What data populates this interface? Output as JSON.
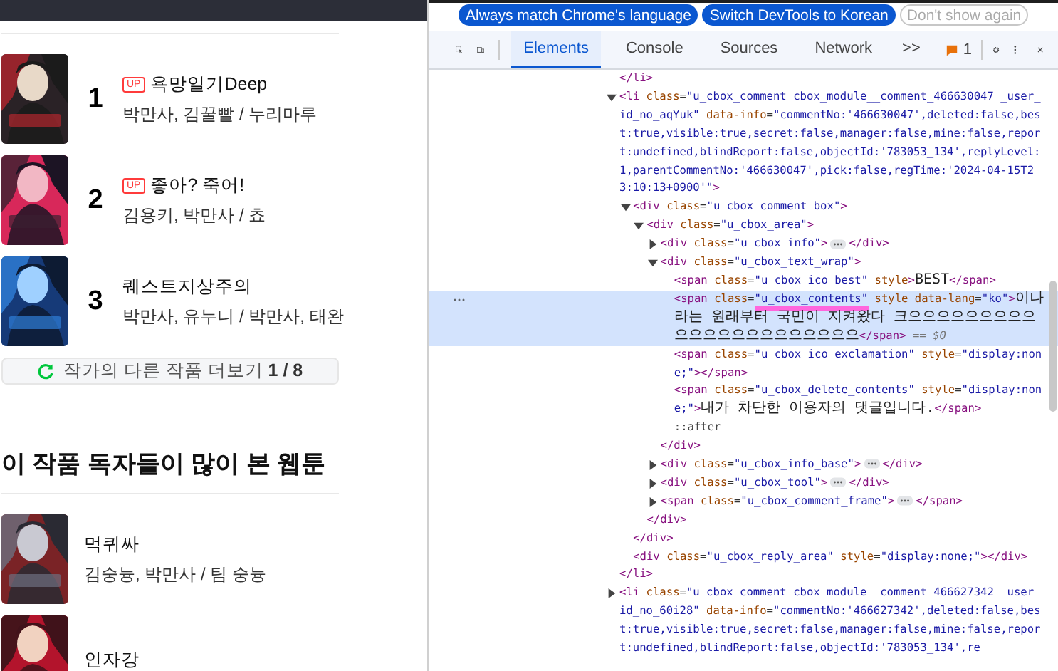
{
  "page": {
    "rankings": [
      {
        "rank": "1",
        "badge": "UP",
        "title": "욕망일기Deep",
        "authors": "박만사, 김꿀빨 / 누리마루"
      },
      {
        "rank": "2",
        "badge": "UP",
        "title": "좋아? 죽어!",
        "authors": "김용키, 박만사 / 쵸"
      },
      {
        "rank": "3",
        "title": "퀘스트지상주의",
        "authors": "박만사, 유누니 / 박만사, 태완"
      }
    ],
    "more_button": "작가의 다른 작품 더보기 **1 / 8**",
    "section_title": "이 작품 독자들이 많이 본 웹툰",
    "recommendations": [
      {
        "title": "먹퀴싸",
        "authors": "김숭늉, 박만사 / 팀 숭늉"
      },
      {
        "title": "인자강"
      }
    ]
  },
  "devtools": {
    "infobar": [
      {
        "label": "Always match Chrome's language",
        "kind": "primary"
      },
      {
        "label": "Switch DevTools to Korean",
        "kind": "primary"
      },
      {
        "label": "Don't show again",
        "kind": "outline"
      }
    ],
    "tabs": [
      {
        "label": "Elements",
        "selected": true
      },
      {
        "label": "Console",
        "selected": false
      },
      {
        "label": "Sources",
        "selected": false
      },
      {
        "label": "Network",
        "selected": false
      }
    ],
    "overflow": ">>",
    "issues": "1",
    "dom": [
      {
        "line": [
          {
            "kind": "tag",
            "text": "</li>"
          }
        ]
      },
      {
        "expanded": true,
        "line": [
          {
            "kind": "tag",
            "text": "<li"
          },
          {
            "kind": "attr",
            "text": " class"
          },
          {
            "kind": "punct",
            "text": "="
          },
          {
            "kind": "value",
            "text": "\"u_cbox_comment cbox_module__comment_466630047 _user_id_no_aqYuk\""
          },
          {
            "kind": "attr",
            "text": " data-info"
          },
          {
            "kind": "punct",
            "text": "="
          },
          {
            "kind": "value",
            "text": "\"commentNo:'466630047',deleted:false,best:true,visible:true,secret:false,manager:false,mine:false,report:undefined,blindReport:false,objectId:'783053_134',replyLevel:1,parentCommentNo:'466630047',pick:false,regTime:'2024-04-15T23:10:13+0900'\""
          },
          {
            "kind": "tag",
            "text": ">"
          }
        ],
        "children": [
          {
            "expanded": true,
            "line": [
              {
                "kind": "tag",
                "text": "<div"
              },
              {
                "kind": "attr",
                "text": " class"
              },
              {
                "kind": "punct",
                "text": "="
              },
              {
                "kind": "value",
                "text": "\"u_cbox_comment_box\""
              },
              {
                "kind": "tag",
                "text": ">"
              }
            ],
            "children": [
              {
                "expanded": true,
                "line": [
                  {
                    "kind": "tag",
                    "text": "<div"
                  },
                  {
                    "kind": "attr",
                    "text": " class"
                  },
                  {
                    "kind": "punct",
                    "text": "="
                  },
                  {
                    "kind": "value",
                    "text": "\"u_cbox_area\""
                  },
                  {
                    "kind": "tag",
                    "text": ">"
                  }
                ],
                "children": [
                  {
                    "expanded": false,
                    "line": [
                      {
                        "kind": "tag",
                        "text": "<div"
                      },
                      {
                        "kind": "attr",
                        "text": " class"
                      },
                      {
                        "kind": "punct",
                        "text": "="
                      },
                      {
                        "kind": "value",
                        "text": "\"u_cbox_info\""
                      },
                      {
                        "kind": "tag",
                        "text": ">"
                      },
                      {
                        "kind": "ellipsis"
                      },
                      {
                        "kind": "tag",
                        "text": "</div>"
                      }
                    ]
                  },
                  {
                    "expanded": true,
                    "line": [
                      {
                        "kind": "tag",
                        "text": "<div"
                      },
                      {
                        "kind": "attr",
                        "text": " class"
                      },
                      {
                        "kind": "punct",
                        "text": "="
                      },
                      {
                        "kind": "value",
                        "text": "\"u_cbox_text_wrap\""
                      },
                      {
                        "kind": "tag",
                        "text": ">"
                      }
                    ],
                    "children": [
                      {
                        "line": [
                          {
                            "kind": "tag",
                            "text": "<span"
                          },
                          {
                            "kind": "attr",
                            "text": " class"
                          },
                          {
                            "kind": "punct",
                            "text": "="
                          },
                          {
                            "kind": "value",
                            "text": "\"u_cbox_ico_best\""
                          },
                          {
                            "kind": "attr",
                            "text": " style"
                          },
                          {
                            "kind": "tag",
                            "text": ">"
                          },
                          {
                            "kind": "text",
                            "text": "BEST"
                          },
                          {
                            "kind": "tag",
                            "text": "</span>"
                          }
                        ]
                      },
                      {
                        "selected": true,
                        "line": [
                          {
                            "kind": "tag",
                            "text": "<span"
                          },
                          {
                            "kind": "attr",
                            "text": " class"
                          },
                          {
                            "kind": "punct",
                            "text": "="
                          },
                          {
                            "kind": "value",
                            "text": "\"u_cbox_contents\"",
                            "marked": true
                          },
                          {
                            "kind": "attr",
                            "text": " style data-lang"
                          },
                          {
                            "kind": "punct",
                            "text": "="
                          },
                          {
                            "kind": "value",
                            "text": "\"ko\""
                          },
                          {
                            "kind": "tag",
                            "text": ">"
                          },
                          {
                            "kind": "text",
                            "text": "이나라는 원래부터 국민이 지켜왔다 크으으으으으으으으으으으으으으으으으으으으으으"
                          },
                          {
                            "kind": "tag",
                            "text": "</span>"
                          },
                          {
                            "kind": "ref",
                            "text": " == $0"
                          }
                        ]
                      },
                      {
                        "line": [
                          {
                            "kind": "tag",
                            "text": "<span"
                          },
                          {
                            "kind": "attr",
                            "text": " class"
                          },
                          {
                            "kind": "punct",
                            "text": "="
                          },
                          {
                            "kind": "value",
                            "text": "\"u_cbox_ico_exclamation\""
                          },
                          {
                            "kind": "attr",
                            "text": " style"
                          },
                          {
                            "kind": "punct",
                            "text": "="
                          },
                          {
                            "kind": "value",
                            "text": "\"display:none;\""
                          },
                          {
                            "kind": "tag",
                            "text": "></span>"
                          }
                        ]
                      },
                      {
                        "line": [
                          {
                            "kind": "tag",
                            "text": "<span"
                          },
                          {
                            "kind": "attr",
                            "text": " class"
                          },
                          {
                            "kind": "punct",
                            "text": "="
                          },
                          {
                            "kind": "value",
                            "text": "\"u_cbox_delete_contents\""
                          },
                          {
                            "kind": "attr",
                            "text": " style"
                          },
                          {
                            "kind": "punct",
                            "text": "="
                          },
                          {
                            "kind": "value",
                            "text": "\"display:none;\""
                          },
                          {
                            "kind": "tag",
                            "text": ">"
                          },
                          {
                            "kind": "text",
                            "text": "내가 차단한 이용자의 댓글입니다."
                          },
                          {
                            "kind": "tag",
                            "text": "</span>"
                          }
                        ]
                      },
                      {
                        "line": [
                          {
                            "kind": "pseudo",
                            "text": "::after"
                          }
                        ]
                      }
                    ],
                    "closing": [
                      {
                        "kind": "tag",
                        "text": "</div>"
                      }
                    ]
                  },
                  {
                    "expanded": false,
                    "line": [
                      {
                        "kind": "tag",
                        "text": "<div"
                      },
                      {
                        "kind": "attr",
                        "text": " class"
                      },
                      {
                        "kind": "punct",
                        "text": "="
                      },
                      {
                        "kind": "value",
                        "text": "\"u_cbox_info_base\""
                      },
                      {
                        "kind": "tag",
                        "text": ">"
                      },
                      {
                        "kind": "ellipsis"
                      },
                      {
                        "kind": "tag",
                        "text": "</div>"
                      }
                    ]
                  },
                  {
                    "expanded": false,
                    "line": [
                      {
                        "kind": "tag",
                        "text": "<div"
                      },
                      {
                        "kind": "attr",
                        "text": " class"
                      },
                      {
                        "kind": "punct",
                        "text": "="
                      },
                      {
                        "kind": "value",
                        "text": "\"u_cbox_tool\""
                      },
                      {
                        "kind": "tag",
                        "text": ">"
                      },
                      {
                        "kind": "ellipsis"
                      },
                      {
                        "kind": "tag",
                        "text": "</div>"
                      }
                    ]
                  },
                  {
                    "expanded": false,
                    "line": [
                      {
                        "kind": "tag",
                        "text": "<span"
                      },
                      {
                        "kind": "attr",
                        "text": " class"
                      },
                      {
                        "kind": "punct",
                        "text": "="
                      },
                      {
                        "kind": "value",
                        "text": "\"u_cbox_comment_frame\""
                      },
                      {
                        "kind": "tag",
                        "text": ">"
                      },
                      {
                        "kind": "ellipsis"
                      },
                      {
                        "kind": "tag",
                        "text": "</span>"
                      }
                    ]
                  }
                ],
                "closing": [
                  {
                    "kind": "tag",
                    "text": "</div>"
                  }
                ]
              }
            ],
            "closing": [
              {
                "kind": "tag",
                "text": "</div>"
              }
            ]
          },
          {
            "line": [
              {
                "kind": "tag",
                "text": "<div"
              },
              {
                "kind": "attr",
                "text": " class"
              },
              {
                "kind": "punct",
                "text": "="
              },
              {
                "kind": "value",
                "text": "\"u_cbox_reply_area\""
              },
              {
                "kind": "attr",
                "text": " style"
              },
              {
                "kind": "punct",
                "text": "="
              },
              {
                "kind": "value",
                "text": "\"display:none;\""
              },
              {
                "kind": "tag",
                "text": "></div>"
              }
            ]
          }
        ],
        "closing": [
          {
            "kind": "tag",
            "text": "</li>"
          }
        ]
      },
      {
        "expanded": false,
        "line": [
          {
            "kind": "tag",
            "text": "<li"
          },
          {
            "kind": "attr",
            "text": " class"
          },
          {
            "kind": "punct",
            "text": "="
          },
          {
            "kind": "value",
            "text": "\"u_cbox_comment cbox_module__comment_466627342 _user_id_no_60i28\""
          },
          {
            "kind": "attr",
            "text": " data-info"
          },
          {
            "kind": "punct",
            "text": "="
          },
          {
            "kind": "value",
            "text": "\"commentNo:'466627342',deleted:false,best:true,visible:true,secret:false,manager:false,mine:false,report:undefined,blindReport:false,objectId:'783053_134',re"
          }
        ]
      }
    ]
  }
}
